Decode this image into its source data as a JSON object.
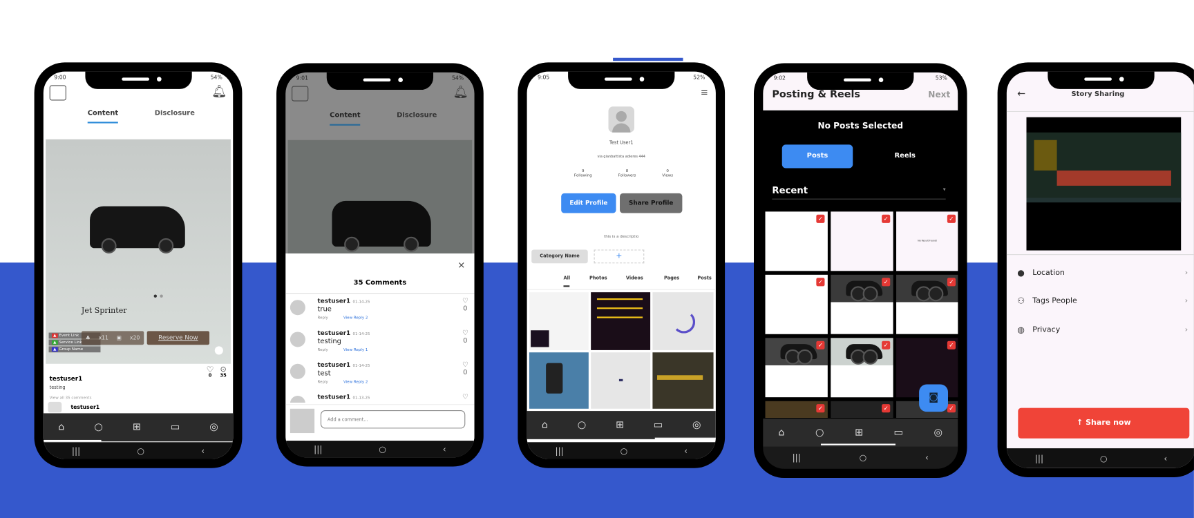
{
  "phone1": {
    "status_time": "9:00",
    "status_battery": "54%",
    "tabs": [
      "Content",
      "Disclosure"
    ],
    "post_title": "Jet Sprinter",
    "badges": [
      "Event Link",
      "Service Link",
      "Group Name"
    ],
    "passengers": "x11",
    "luggage": "x20",
    "reserve_label": "Reserve Now",
    "username": "testuser1",
    "caption": "testing",
    "likes": "0",
    "comments": "35",
    "view_all": "View all 35 comments",
    "next_username": "testuser1"
  },
  "phone2": {
    "status_time": "9:01",
    "status_battery": "54%",
    "tabs": [
      "Content",
      "Disclosure"
    ],
    "sheet_title": "35 Comments",
    "comments": [
      {
        "user": "testuser1",
        "date": "01-14-25",
        "text": "true",
        "reply": "Reply",
        "view": "View Reply 2",
        "likes": "0"
      },
      {
        "user": "testuser1",
        "date": "01-14-25",
        "text": "testing",
        "reply": "Reply",
        "view": "View Reply 1",
        "likes": "0"
      },
      {
        "user": "testuser1",
        "date": "01-14-25",
        "text": "test",
        "reply": "Reply",
        "view": "View Reply 2",
        "likes": "0"
      },
      {
        "user": "testuser1",
        "date": "01-13-25"
      }
    ],
    "comment_placeholder": "Add a comment..."
  },
  "phone3": {
    "status_time": "9:05",
    "status_battery": "52%",
    "name": "Test User1",
    "address": "via gianbattista adieres 444",
    "stats": [
      {
        "value": "9",
        "label": "Following"
      },
      {
        "value": "8",
        "label": "Followers"
      },
      {
        "value": "0",
        "label": "Views"
      }
    ],
    "edit_label": "Edit Profile",
    "share_label": "Share Profile",
    "description": "this is a descriptio",
    "category": "Category Name",
    "add": "+",
    "tabs": [
      "All",
      "Photos",
      "Videos",
      "Pages",
      "Posts"
    ]
  },
  "phone4": {
    "status_time": "9:02",
    "status_battery": "53%",
    "title": "Posting & Reels",
    "next_label": "Next",
    "empty_label": "No Posts Selected",
    "toggle": [
      "Posts",
      "Reels"
    ],
    "section": "Recent",
    "thumb_text": "No Result Found!"
  },
  "phone5": {
    "title": "Story Sharing",
    "options": [
      "Location",
      "Tags People",
      "Privacy"
    ],
    "share_label": "Share now"
  },
  "colors": {
    "brand_blue": "#3558cc",
    "accent_blue": "#3d8bf2",
    "red": "#f04438"
  }
}
